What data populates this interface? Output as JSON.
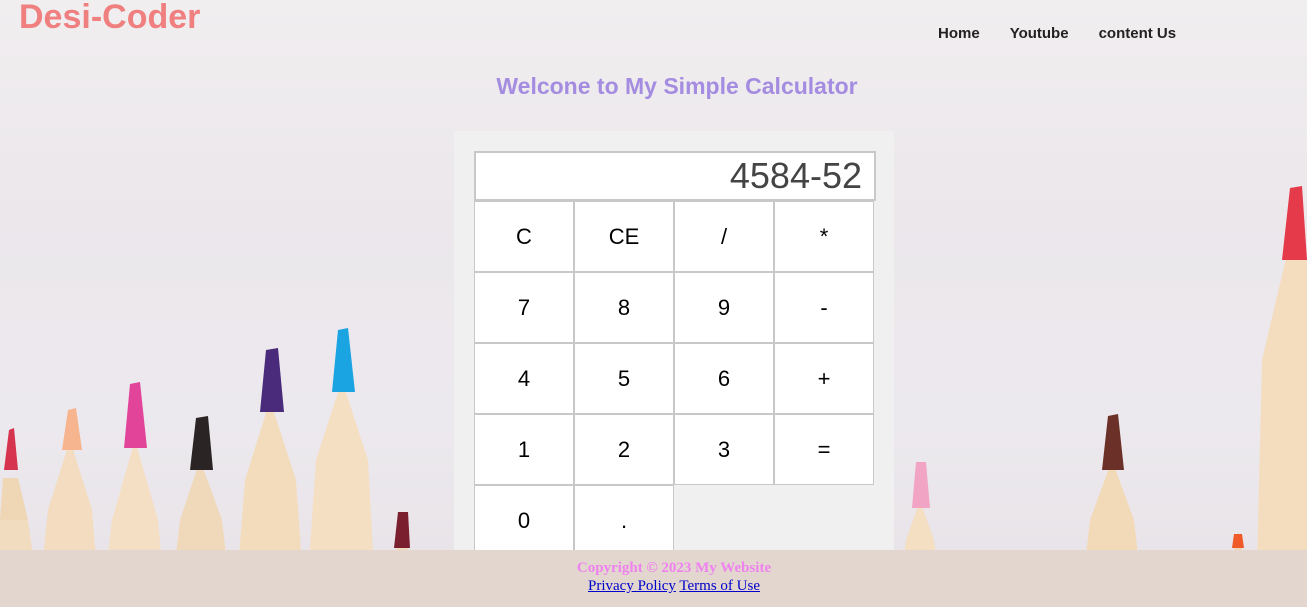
{
  "header": {
    "logo": "Desi-Coder",
    "nav": [
      "Home",
      "Youtube",
      "content Us"
    ]
  },
  "welcome": "Welcone to My Simple Calculator",
  "calculator": {
    "display": "4584-52",
    "keys": {
      "clear": "C",
      "clear_entry": "CE",
      "divide": "/",
      "multiply": "*",
      "seven": "7",
      "eight": "8",
      "nine": "9",
      "minus": "-",
      "four": "4",
      "five": "5",
      "six": "6",
      "plus": "+",
      "one": "1",
      "two": "2",
      "three": "3",
      "equals": "=",
      "zero": "0",
      "dot": "."
    }
  },
  "footer": {
    "copyright": "Copyright © 2023 My Website",
    "privacy": "Privacy Policy",
    "terms": "Terms of Use"
  },
  "colors": {
    "logo": "#f08080",
    "welcome": "#a48de0",
    "copyright": "#ee82ee",
    "footer_bg": "#e2d6ce"
  }
}
